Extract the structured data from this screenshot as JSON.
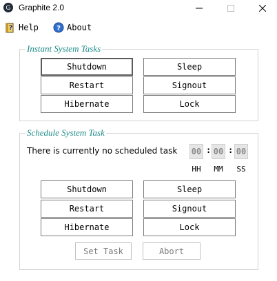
{
  "window": {
    "title": "Graphite 2.0",
    "app_icon_glyph": "G",
    "controls": {
      "minimize": "minimize-icon",
      "maximize": "maximize-icon",
      "close": "close-icon"
    }
  },
  "menu": {
    "help": {
      "label": "Help",
      "icon": "help-book-icon"
    },
    "about": {
      "label": "About",
      "icon": "question-circle-icon"
    }
  },
  "instant": {
    "title": "Instant System Tasks",
    "shutdown": "Shutdown",
    "sleep": "Sleep",
    "restart": "Restart",
    "signout": "Signout",
    "hibernate": "Hibernate",
    "lock": "Lock"
  },
  "schedule": {
    "title": "Schedule System Task",
    "status": "There is currently no scheduled task",
    "time": {
      "hh": "00",
      "mm": "00",
      "ss": "00",
      "separator": ":"
    },
    "labels": {
      "hh": "HH",
      "mm": "MM",
      "ss": "SS"
    },
    "shutdown": "Shutdown",
    "sleep": "Sleep",
    "restart": "Restart",
    "signout": "Signout",
    "hibernate": "Hibernate",
    "lock": "Lock",
    "set_task": "Set Task",
    "abort": "Abort"
  },
  "colors": {
    "legend": "#1a8a86",
    "border": "#7a7a7a",
    "time_box_bg": "#e6e6e6"
  }
}
